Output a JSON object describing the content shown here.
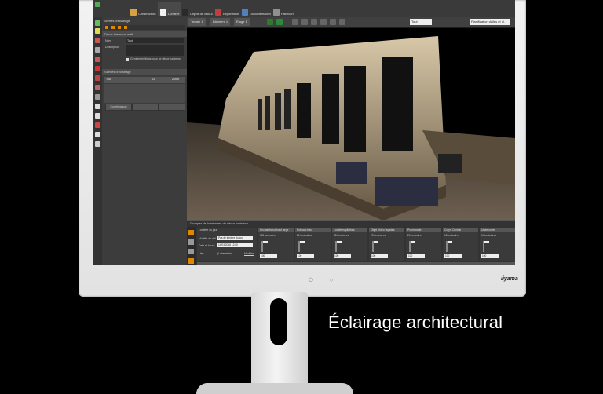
{
  "caption": "Éclairage architectural",
  "brand": "iiyama",
  "app": {
    "ribbon_tabs": [
      {
        "label": "Construction",
        "color": "#d8a040"
      },
      {
        "label": "Lumière",
        "color": "#f0f0f0"
      },
      {
        "label": "Objets de calcul",
        "color": "#2a2a2a"
      },
      {
        "label": "Exportation",
        "color": "#c04040"
      },
      {
        "label": "Documentation",
        "color": "#5080c0"
      },
      {
        "label": "Fabricant",
        "color": "#909090"
      }
    ],
    "view_tabs": [
      "Terrain 1",
      "Bâtiment 1",
      "Étage 1"
    ],
    "toolbar_select": "Tout",
    "toolbar_select2": "Planification dallés et pl.",
    "left_panel": {
      "title": "Scènes d'éclairage",
      "section1": "Décor lumineux actif",
      "name_label": "Nom",
      "name_value": "Tout",
      "desc_label": "Description",
      "checkbox_label": "Générer éditions pour ce décor lumineux",
      "section2": "Scènes d'éclairage",
      "row_name": "Tout",
      "row_num": "01",
      "row_val": "200/h",
      "button1": "Combinaison"
    },
    "bottom_panel": {
      "title": "Groupes de luminaires du décor lumineux",
      "light_label": "Lumière du jour",
      "sky_label": "Modèle de ciel",
      "sky_value": "Pas de lumière du jour",
      "date_label": "Date et heure",
      "date_value": "14/03/2018 12:00",
      "place_label": "Lieu",
      "place_value": "(Lohenstein)",
      "place_btn": "Modifier",
      "columns": [
        {
          "title": "Encastrés sol haut large",
          "count": "105 luminaires",
          "value": "100"
        },
        {
          "title": "Poteaux bas",
          "count": "21 luminaires",
          "value": "100"
        },
        {
          "title": "Lumières plinthes",
          "count": "48 luminaires",
          "value": "100"
        },
        {
          "title": "Objet Vidéo façades",
          "count": "23 luminaires",
          "value": "100"
        },
        {
          "title": "Promenade",
          "count": "20 luminaires",
          "value": "100"
        },
        {
          "title": "Corps Central",
          "count": "18 luminaires",
          "value": "100"
        },
        {
          "title": "Undercover",
          "count": "14 luminaires",
          "value": "100"
        }
      ]
    }
  }
}
